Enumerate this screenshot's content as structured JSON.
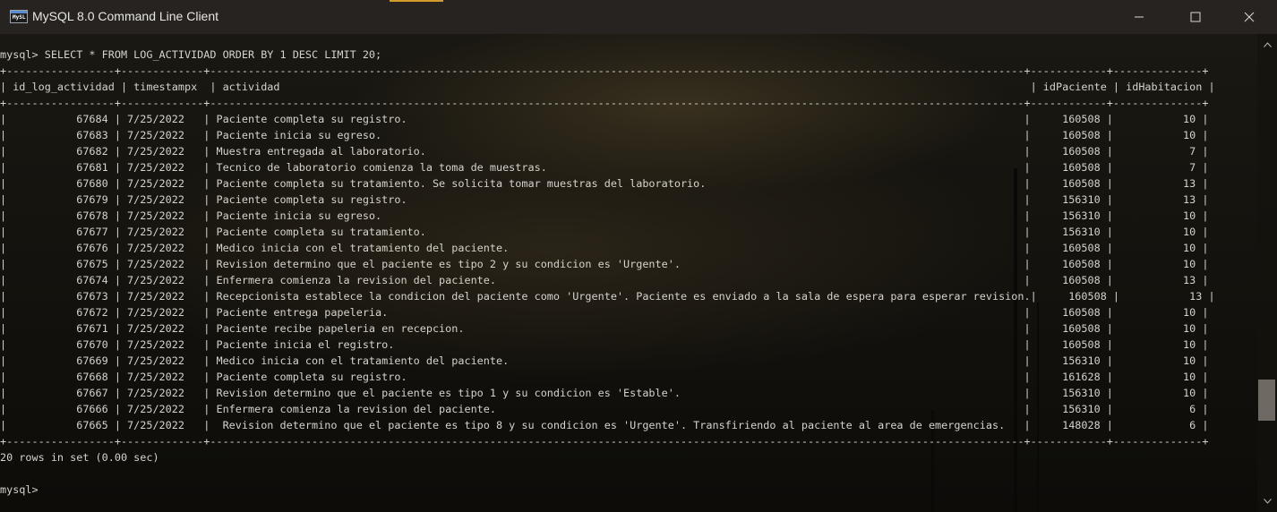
{
  "window": {
    "title": "MySQL 8.0 Command Line Client",
    "accent_color": "#d39b2a",
    "icon_text": "MySL"
  },
  "console": {
    "lines": [
      "mysql> SELECT * FROM LOG_ACTIVIDAD ORDER BY 1 DESC LIMIT 20;",
      "+-----------------+-------------+--------------------------------------------------------------------------------------------------------------------------------+------------+--------------+",
      "| id_log_actividad | timestampx  | actividad                                                                                                                      | idPaciente | idHabitacion |",
      "+-----------------+-------------+--------------------------------------------------------------------------------------------------------------------------------+------------+--------------+",
      "|           67684 | 7/25/2022   | Paciente completa su registro.                                                                                                 |     160508 |           10 |",
      "|           67683 | 7/25/2022   | Paciente inicia su egreso.                                                                                                     |     160508 |           10 |",
      "|           67682 | 7/25/2022   | Muestra entregada al laboratorio.                                                                                              |     160508 |            7 |",
      "|           67681 | 7/25/2022   | Tecnico de laboratorio comienza la toma de muestras.                                                                           |     160508 |            7 |",
      "|           67680 | 7/25/2022   | Paciente completa su tratamiento. Se solicita tomar muestras del laboratorio.                                                  |     160508 |           13 |",
      "|           67679 | 7/25/2022   | Paciente completa su registro.                                                                                                 |     156310 |           13 |",
      "|           67678 | 7/25/2022   | Paciente inicia su egreso.                                                                                                     |     156310 |           10 |",
      "|           67677 | 7/25/2022   | Paciente completa su tratamiento.                                                                                              |     156310 |           10 |",
      "|           67676 | 7/25/2022   | Medico inicia con el tratamiento del paciente.                                                                                 |     160508 |           10 |",
      "|           67675 | 7/25/2022   | Revision determino que el paciente es tipo 2 y su condicion es 'Urgente'.                                                      |     160508 |           10 |",
      "|           67674 | 7/25/2022   | Enfermera comienza la revision del paciente.                                                                                   |     160508 |           13 |",
      "|           67673 | 7/25/2022   | Recepcionista establece la condicion del paciente como 'Urgente'. Paciente es enviado a la sala de espera para esperar revision.|     160508 |           13 |",
      "|           67672 | 7/25/2022   | Paciente entrega papeleria.                                                                                                    |     160508 |           10 |",
      "|           67671 | 7/25/2022   | Paciente recibe papeleria en recepcion.                                                                                        |     160508 |           10 |",
      "|           67670 | 7/25/2022   | Paciente inicia el registro.                                                                                                   |     160508 |           10 |",
      "|           67669 | 7/25/2022   | Medico inicia con el tratamiento del paciente.                                                                                 |     156310 |           10 |",
      "|           67668 | 7/25/2022   | Paciente completa su registro.                                                                                                 |     161628 |           10 |",
      "|           67667 | 7/25/2022   | Revision determino que el paciente es tipo 1 y su condicion es 'Estable'.                                                      |     156310 |           10 |",
      "|           67666 | 7/25/2022   | Enfermera comienza la revision del paciente.                                                                                   |     156310 |            6 |",
      "|           67665 | 7/25/2022   |  Revision determino que el paciente es tipo 8 y su condicion es 'Urgente'. Transfiriendo al paciente al area de emergencias.   |     148028 |            6 |",
      "+-----------------+-------------+--------------------------------------------------------------------------------------------------------------------------------+------------+--------------+",
      "20 rows in set (0.00 sec)",
      "",
      "mysql>"
    ]
  }
}
